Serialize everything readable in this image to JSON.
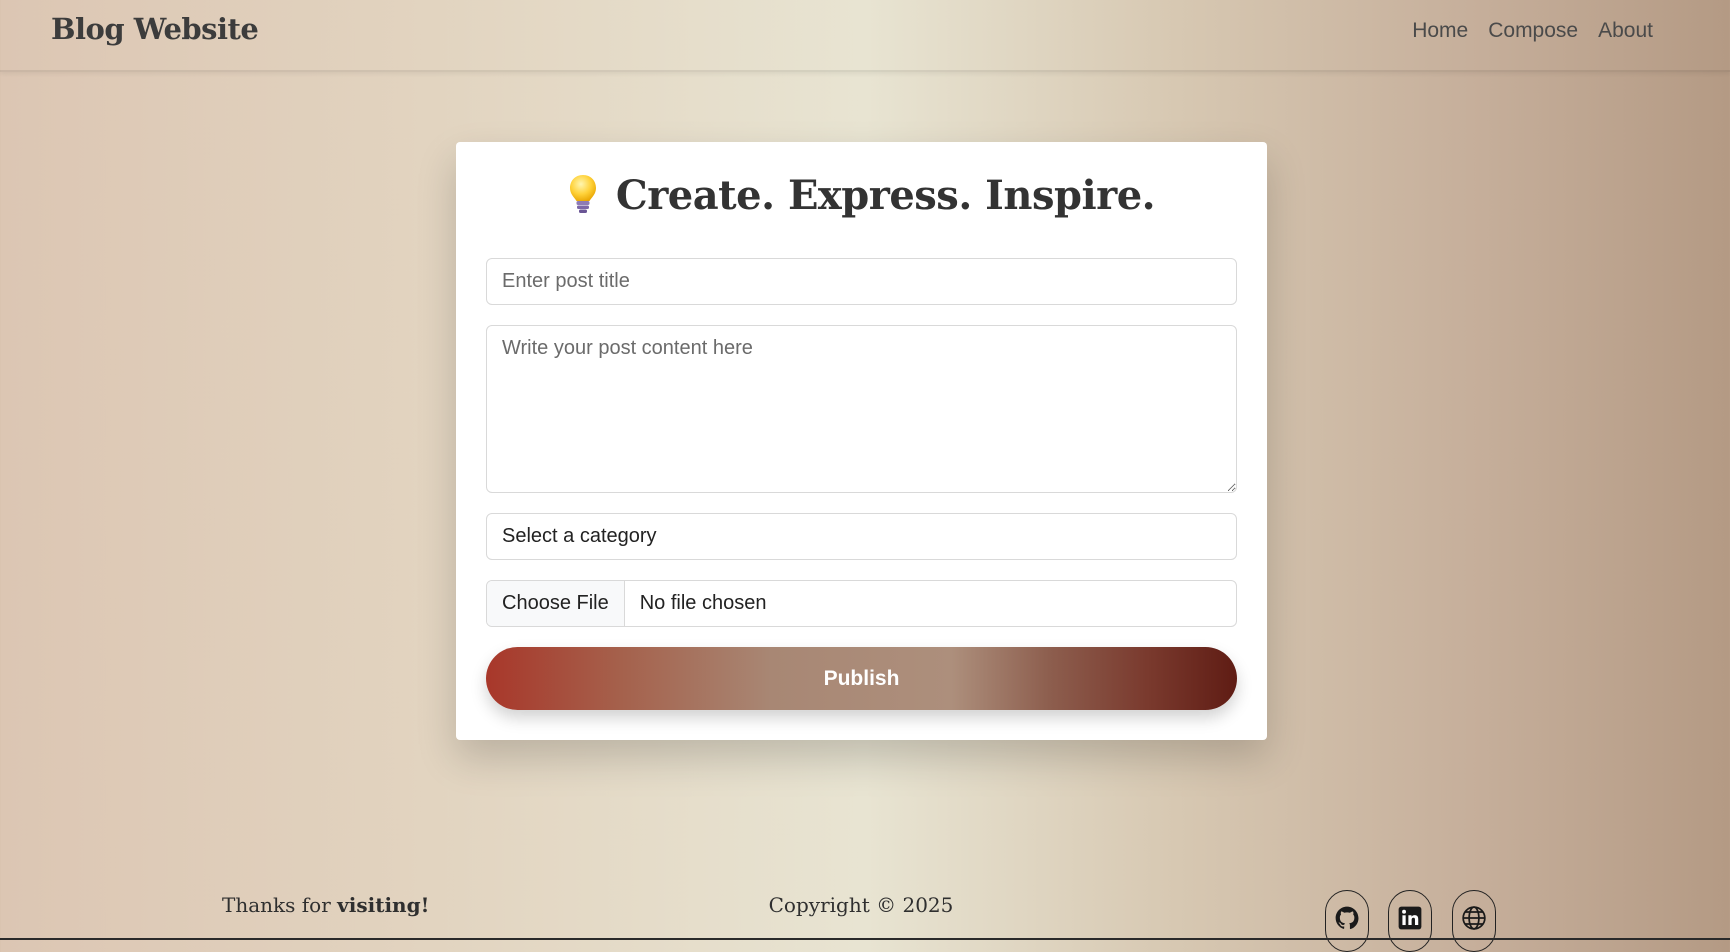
{
  "navbar": {
    "brand": "Blog Website",
    "links": [
      "Home",
      "Compose",
      "About"
    ]
  },
  "compose": {
    "title": "Create. Express. Inspire.",
    "title_icon": "lightbulb-icon",
    "title_placeholder": "Enter post title",
    "content_placeholder": "Write your post content here",
    "category_selected": "Select a category",
    "file_button_label": "Choose File",
    "file_status": "No file chosen",
    "publish_label": "Publish"
  },
  "footer": {
    "thanks_prefix": "Thanks for",
    "thanks_bold": "visiting!",
    "copyright": "Copyright © 2025",
    "social_icons": [
      "github-icon",
      "linkedin-icon",
      "globe-icon"
    ]
  },
  "colors": {
    "publish_gradient_start": "#a8372a",
    "publish_gradient_end": "#5f1c14"
  }
}
